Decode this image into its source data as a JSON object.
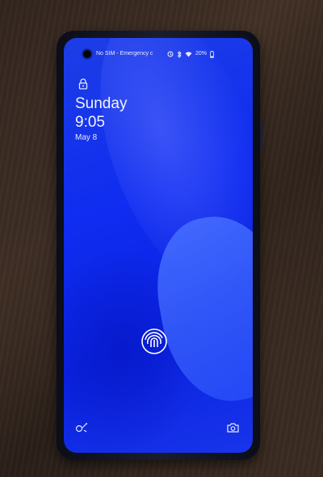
{
  "status_bar": {
    "carrier_text": "No SIM - Emergency c",
    "battery": "20%"
  },
  "lock_screen": {
    "day": "Sunday",
    "time": "9:05",
    "date": "May 8"
  },
  "colors": {
    "screen_blue": "#0f2cf0",
    "text": "#f2f4ff",
    "table_wood": "#3a2b23"
  },
  "icons": [
    "lock-icon",
    "fingerprint-icon",
    "voice-assistant-icon",
    "camera-icon",
    "bluetooth-icon",
    "wifi-icon",
    "battery-icon"
  ]
}
